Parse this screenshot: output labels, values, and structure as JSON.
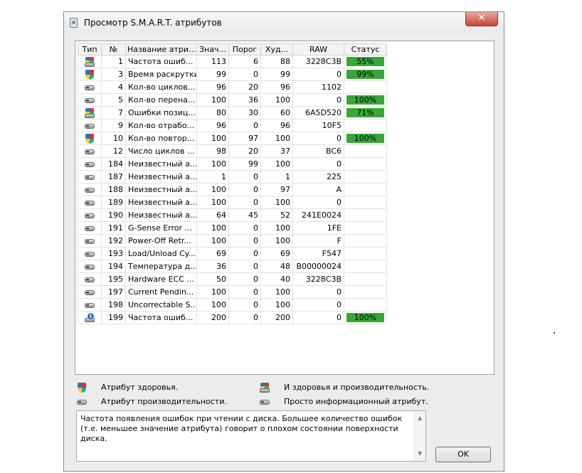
{
  "window": {
    "title": "Просмотр S.M.A.R.T. атрибутов",
    "close_glyph": "✕"
  },
  "table": {
    "headers": [
      "Тип",
      "№",
      "Название атри...",
      "Знач...",
      "Порог",
      "Худ...",
      "RAW",
      "Статус"
    ],
    "rows": [
      {
        "type": "both-icon",
        "id": "1",
        "name": "Частота ошиб...",
        "value": "113",
        "threshold": "6",
        "worst": "88",
        "raw": "3228C3B",
        "status": "55%"
      },
      {
        "type": "shield-icon",
        "id": "3",
        "name": "Время раскрутки",
        "value": "99",
        "threshold": "0",
        "worst": "99",
        "raw": "0",
        "status": "99%"
      },
      {
        "type": "disk-icon",
        "id": "4",
        "name": "Кол-во циклов...",
        "value": "96",
        "threshold": "20",
        "worst": "96",
        "raw": "1102",
        "status": ""
      },
      {
        "type": "disk-icon",
        "id": "5",
        "name": "Кол-во перена...",
        "value": "100",
        "threshold": "36",
        "worst": "100",
        "raw": "0",
        "status": "100%"
      },
      {
        "type": "both-icon",
        "id": "7",
        "name": "Ошибки позиц...",
        "value": "80",
        "threshold": "30",
        "worst": "60",
        "raw": "6A5D520",
        "status": "71%"
      },
      {
        "type": "disk-icon",
        "id": "9",
        "name": "Кол-во отрабо...",
        "value": "96",
        "threshold": "0",
        "worst": "96",
        "raw": "10F5",
        "status": ""
      },
      {
        "type": "shield-icon",
        "id": "10",
        "name": "Кол-во повтор...",
        "value": "100",
        "threshold": "97",
        "worst": "100",
        "raw": "0",
        "status": "100%"
      },
      {
        "type": "disk-icon",
        "id": "12",
        "name": "Число циклов ...",
        "value": "98",
        "threshold": "20",
        "worst": "37",
        "raw": "BC6",
        "status": ""
      },
      {
        "type": "disk-icon",
        "id": "184",
        "name": "Неизвестный а...",
        "value": "100",
        "threshold": "99",
        "worst": "100",
        "raw": "0",
        "status": ""
      },
      {
        "type": "disk-icon",
        "id": "187",
        "name": "Неизвестный а...",
        "value": "1",
        "threshold": "0",
        "worst": "1",
        "raw": "225",
        "status": ""
      },
      {
        "type": "disk-icon",
        "id": "188",
        "name": "Неизвестный а...",
        "value": "100",
        "threshold": "0",
        "worst": "97",
        "raw": "A",
        "status": ""
      },
      {
        "type": "disk-icon",
        "id": "189",
        "name": "Неизвестный а...",
        "value": "100",
        "threshold": "0",
        "worst": "100",
        "raw": "0",
        "status": ""
      },
      {
        "type": "disk-icon",
        "id": "190",
        "name": "Неизвестный а...",
        "value": "64",
        "threshold": "45",
        "worst": "52",
        "raw": "241E0024",
        "status": ""
      },
      {
        "type": "disk-icon",
        "id": "191",
        "name": "G-Sense Error ...",
        "value": "100",
        "threshold": "0",
        "worst": "100",
        "raw": "1FE",
        "status": ""
      },
      {
        "type": "disk-icon",
        "id": "192",
        "name": "Power-Off Retr...",
        "value": "100",
        "threshold": "0",
        "worst": "100",
        "raw": "F",
        "status": ""
      },
      {
        "type": "disk-icon",
        "id": "193",
        "name": "Load/Unload Cy...",
        "value": "69",
        "threshold": "0",
        "worst": "69",
        "raw": "F547",
        "status": ""
      },
      {
        "type": "disk-icon",
        "id": "194",
        "name": "Температура д...",
        "value": "36",
        "threshold": "0",
        "worst": "48",
        "raw": "B00000024",
        "status": ""
      },
      {
        "type": "disk-icon",
        "id": "195",
        "name": "Hardware ECC ...",
        "value": "50",
        "threshold": "0",
        "worst": "40",
        "raw": "3228C3B",
        "status": ""
      },
      {
        "type": "disk-icon",
        "id": "197",
        "name": "Current Pendin...",
        "value": "100",
        "threshold": "0",
        "worst": "100",
        "raw": "0",
        "status": ""
      },
      {
        "type": "disk-icon",
        "id": "198",
        "name": "Uncorrectable S...",
        "value": "100",
        "threshold": "0",
        "worst": "100",
        "raw": "0",
        "status": ""
      },
      {
        "type": "info-icon",
        "id": "199",
        "name": "Частота ошиб...",
        "value": "200",
        "threshold": "0",
        "worst": "200",
        "raw": "0",
        "status": "100%"
      }
    ],
    "selected_row": 0,
    "status_bar_color": "#3aa63a"
  },
  "legend": {
    "health": "Атрибут здоровья.",
    "performance": "Атрибут производительности.",
    "both": "И здоровья и производительность.",
    "info": "Просто информационный атрибут."
  },
  "description": "Частота появления ошибок при чтении с диска. Большее количество ошибок (т.е. меньшее значение атрибута) говорит о плохом состоянии поверхности диска.",
  "ok_label": "OK"
}
